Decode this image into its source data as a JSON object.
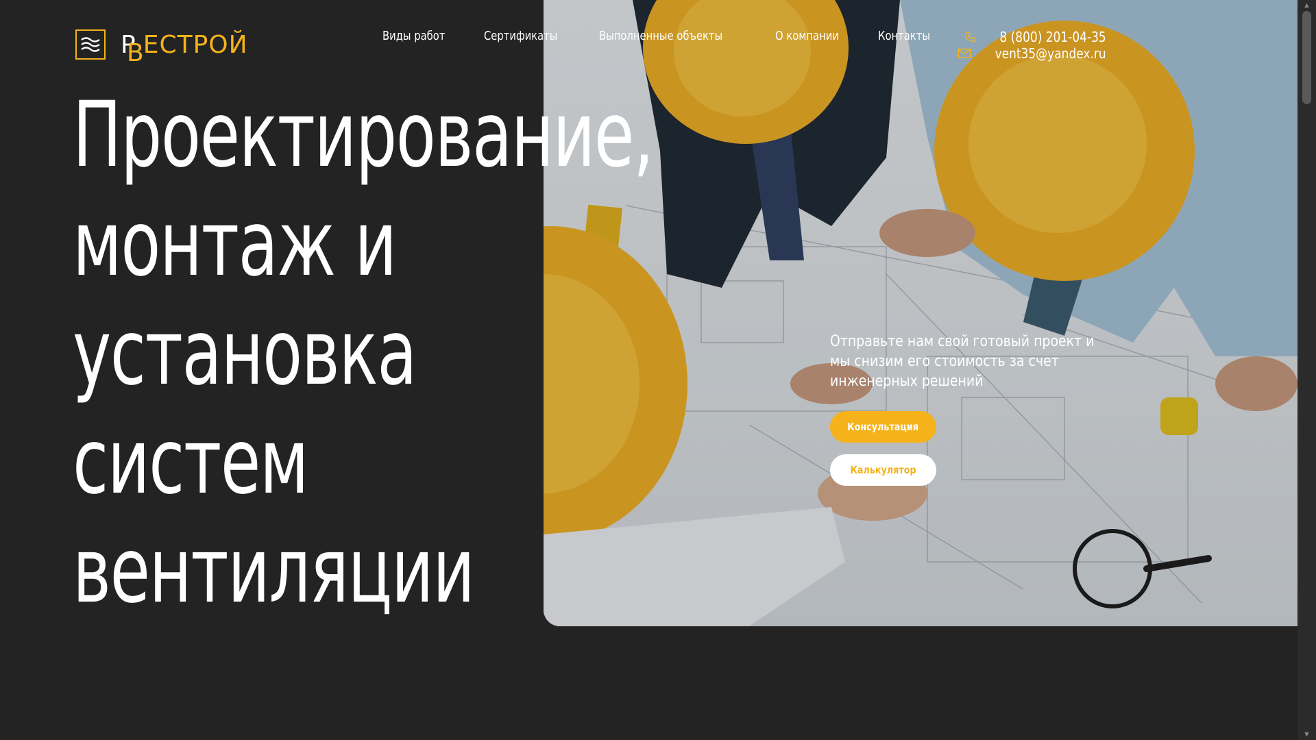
{
  "brand": {
    "logo_letter_p": "Р",
    "logo_letter_b": "В",
    "logo_rest": "ЕСТРОЙ",
    "accent": "#f5b21b"
  },
  "nav": {
    "items": [
      {
        "label": "Виды работ"
      },
      {
        "label": "Сертификаты"
      },
      {
        "label": "Выполненные объекты"
      },
      {
        "label": "О компании"
      },
      {
        "label": "Контакты"
      }
    ]
  },
  "contacts": {
    "phone": "8 (800) 201-04-35",
    "email": "vent35@yandex.ru"
  },
  "hero": {
    "headline_lines": [
      "Проектирование,",
      "монтаж и",
      "установка",
      "систем",
      "вентиляции"
    ],
    "promo_lines": [
      "Отправьте нам свой готовый проект и",
      "мы снизим его стоимость за счет",
      "инженерных решений"
    ],
    "consult_label": "Консультация",
    "calc_label": "Калькулятор"
  },
  "colors": {
    "background": "#232323",
    "accent": "#f5b21b",
    "text": "#ffffff"
  }
}
